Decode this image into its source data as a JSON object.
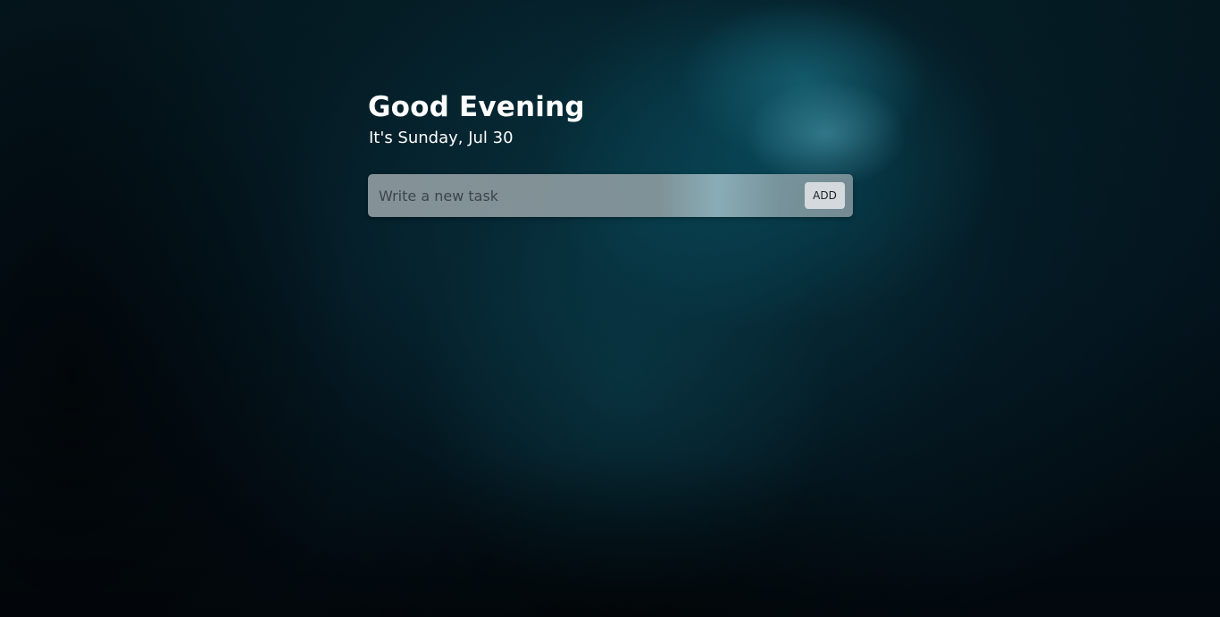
{
  "greeting": {
    "title": "Good Evening",
    "date": "It's Sunday, Jul 30"
  },
  "task_form": {
    "input_placeholder": "Write a new task",
    "input_value": "",
    "add_label": "ADD"
  }
}
